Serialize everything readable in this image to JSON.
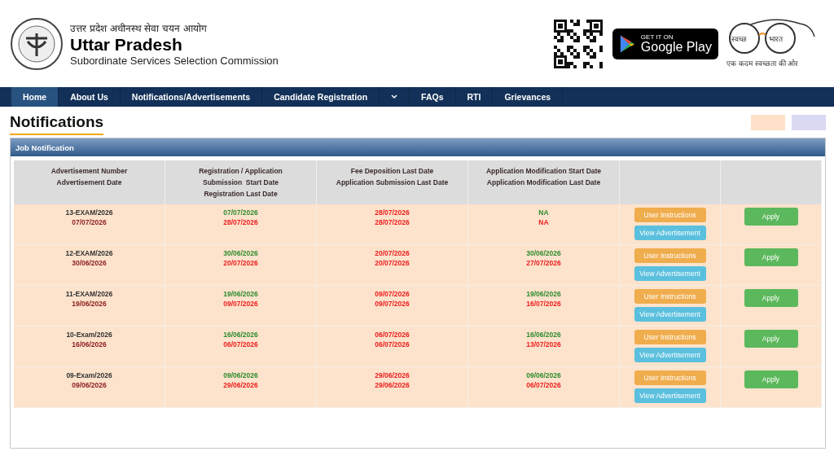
{
  "header": {
    "hindi_name": "उत्तर प्रदेश अधीनस्थ सेवा चयन आयोग",
    "title": "Uttar Pradesh",
    "subtitle": "Subordinate Services Selection Commission",
    "store_badge": {
      "small": "GET IT ON",
      "large": "Google Play"
    },
    "swachh": {
      "left": "स्वच्छ",
      "right": "भारत",
      "tagline": "एक कदम स्वच्छता की ओर"
    }
  },
  "nav": [
    {
      "kind": "link",
      "label": "Home",
      "selected": true
    },
    {
      "kind": "link",
      "label": "About Us",
      "selected": false
    },
    {
      "kind": "link",
      "label": "Notifications/Advertisements",
      "selected": false
    },
    {
      "kind": "link",
      "label": "Candidate Registration",
      "selected": false
    },
    {
      "kind": "dropdown",
      "selected": false
    },
    {
      "kind": "link",
      "label": "FAQs",
      "selected": false
    },
    {
      "kind": "link",
      "label": "RTI",
      "selected": false
    },
    {
      "kind": "link",
      "label": "Grievances",
      "selected": false
    }
  ],
  "page_title": "Notifications",
  "legend": [
    {
      "color": "#fde1c8"
    },
    {
      "color": "#d9d9f3"
    }
  ],
  "panel": {
    "title": "Job Notification",
    "columns": [
      [
        "Advertisement Number",
        "Advertisement Date"
      ],
      [
        "Registration / Application",
        "Submission  Start Date",
        "Registration Last Date"
      ],
      [
        "Fee Deposition Last Date",
        "Application Submission Last Date"
      ],
      [
        "Application Modification Start Date",
        "Application Modification Last Date"
      ],
      [],
      []
    ],
    "rows": [
      {
        "number": "13-EXAM/2026",
        "date": "07/07/2026",
        "reg_start": "07/07/2026",
        "reg_last": "28/07/2026",
        "fee_last": "28/07/2026",
        "sub_last": "28/07/2026",
        "mod_start": "NA",
        "mod_last": "NA",
        "instructions": "User Instructions",
        "view": "View Advertisement",
        "apply": "Apply"
      },
      {
        "number": "12-EXAM/2026",
        "date": "30/06/2026",
        "reg_start": "30/06/2026",
        "reg_last": "20/07/2026",
        "fee_last": "20/07/2026",
        "sub_last": "20/07/2026",
        "mod_start": "30/06/2026",
        "mod_last": "27/07/2026",
        "instructions": "User Instructions",
        "view": "View Advertisement",
        "apply": "Apply"
      },
      {
        "number": "11-EXAM/2026",
        "date": "19/06/2026",
        "reg_start": "19/06/2026",
        "reg_last": "09/07/2026",
        "fee_last": "09/07/2026",
        "sub_last": "09/07/2026",
        "mod_start": "19/06/2026",
        "mod_last": "16/07/2026",
        "instructions": "User Instructions",
        "view": "View Advertisement",
        "apply": "Apply"
      },
      {
        "number": "10-Exam/2026",
        "date": "16/06/2026",
        "reg_start": "16/06/2026",
        "reg_last": "06/07/2026",
        "fee_last": "06/07/2026",
        "sub_last": "06/07/2026",
        "mod_start": "16/06/2026",
        "mod_last": "13/07/2026",
        "instructions": "User Instructions",
        "view": "View Advertisement",
        "apply": "Apply"
      },
      {
        "number": "09-Exam/2026",
        "date": "09/06/2026",
        "reg_start": "09/06/2026",
        "reg_last": "29/06/2026",
        "fee_last": "29/06/2026",
        "sub_last": "29/06/2026",
        "mod_start": "09/06/2026",
        "mod_last": "06/07/2026",
        "instructions": "User Instructions",
        "view": "View Advertisement",
        "apply": "Apply"
      }
    ]
  }
}
